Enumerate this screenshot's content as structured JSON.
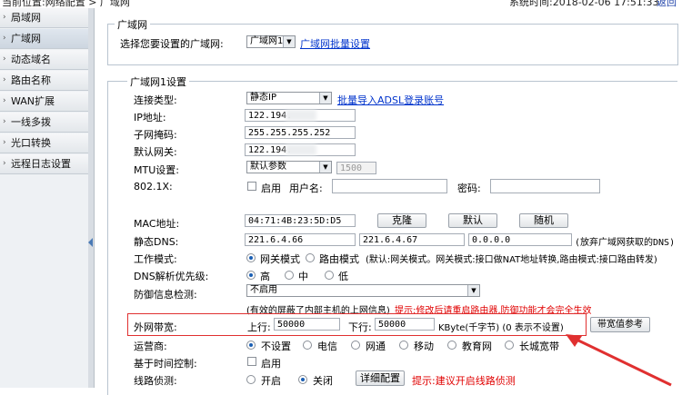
{
  "header": {
    "breadcrumb": "当前位置:网络配置 > 广域网",
    "system_time": "系统时间:2018-02-06 17:51:33",
    "back_link": "返回"
  },
  "sidebar": {
    "items": [
      {
        "label": "局域网",
        "active": false
      },
      {
        "label": "广域网",
        "active": true
      },
      {
        "label": "动态域名",
        "active": false
      },
      {
        "label": "路由名称",
        "active": false
      },
      {
        "label": "WAN扩展",
        "active": false
      },
      {
        "label": "一线多拨",
        "active": false
      },
      {
        "label": "光口转换",
        "active": false
      },
      {
        "label": "远程日志设置",
        "active": false
      }
    ]
  },
  "wan_section": {
    "legend": "广域网",
    "select_label": "选择您要设置的广域网:",
    "select_value": "广域网1",
    "batch_link": "广域网批量设置"
  },
  "wan1": {
    "legend": "广域网1设置",
    "conn_type": {
      "label": "连接类型:",
      "value": "静态IP",
      "link": "批量导入ADSL登录账号"
    },
    "ip": {
      "label": "IP地址:",
      "value": "122.194."
    },
    "mask": {
      "label": "子网掩码:",
      "value": "255.255.255.252"
    },
    "gateway": {
      "label": "默认网关:",
      "value": "122.194."
    },
    "mtu": {
      "label": "MTU设置:",
      "value": "默认参数",
      "number": "1500"
    },
    "dot1x": {
      "label": "802.1X:",
      "enable": "启用",
      "user_label": "用户名:",
      "pwd_label": "密码:"
    },
    "mac": {
      "label": "MAC地址:",
      "value": "04:71:4B:23:5D:D5",
      "btn_clone": "克隆",
      "btn_default": "默认",
      "btn_random": "随机"
    },
    "dns": {
      "label": "静态DNS:",
      "dns1": "221.6.4.66",
      "dns2": "221.6.4.67",
      "dns3": "0.0.0.0",
      "note": "(放弃广域网获取的DNS)"
    },
    "work_mode": {
      "label": "工作模式:",
      "opt1": "网关模式",
      "opt2": "路由模式",
      "desc": "(默认:网关模式。网关模式:接口做NAT地址转换,路由模式:接口路由转发)"
    },
    "dns_priority": {
      "label": "DNS解析优先级:",
      "opt_high": "高",
      "opt_mid": "中",
      "opt_low": "低"
    },
    "defense": {
      "label": "防御信息检测:",
      "value": "不启用",
      "note": "(有效的屏蔽了内部主机的上网信息)",
      "warning": "提示:修改后请重启路由器,防御功能才会完全生效"
    },
    "bandwidth": {
      "label": "外网带宽:",
      "up_label": "上行:",
      "up_value": "50000",
      "down_label": "下行:",
      "down_value": "50000",
      "unit": "KByte(千字节) (0 表示不设置)",
      "ref_btn": "带宽值参考"
    },
    "isp": {
      "label": "运营商:",
      "options": [
        "不设置",
        "电信",
        "网通",
        "移动",
        "教育网",
        "长城宽带"
      ]
    },
    "time_ctrl": {
      "label": "基于时间控制:",
      "enable": "启用"
    },
    "line_detect": {
      "label": "线路侦测:",
      "opt_on": "开启",
      "opt_off": "关闭",
      "btn": "详细配置",
      "tip": "提示:建议开启线路侦测"
    }
  },
  "colors": {
    "accent_link": "#0033cc",
    "warning_red": "#e00000",
    "annotation_red": "#e03030"
  }
}
